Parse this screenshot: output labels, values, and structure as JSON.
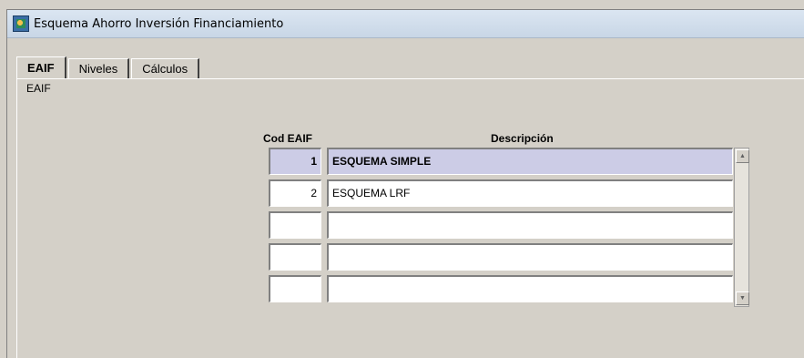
{
  "window": {
    "title": "Esquema Ahorro Inversión Financiamiento",
    "icon": "app-icon"
  },
  "tabs": [
    {
      "label": "EAIF",
      "active": true
    },
    {
      "label": "Niveles",
      "active": false
    },
    {
      "label": "Cálculos",
      "active": false
    }
  ],
  "panel": {
    "label": "EAIF"
  },
  "table": {
    "columns": {
      "cod": "Cod EAIF",
      "desc": "Descripción"
    },
    "rows": [
      {
        "cod": "1",
        "desc": "ESQUEMA SIMPLE"
      },
      {
        "cod": "2",
        "desc": "ESQUEMA LRF"
      },
      {
        "cod": "",
        "desc": ""
      },
      {
        "cod": "",
        "desc": ""
      },
      {
        "cod": "",
        "desc": ""
      }
    ],
    "selected_row_color": "#cccce6"
  }
}
